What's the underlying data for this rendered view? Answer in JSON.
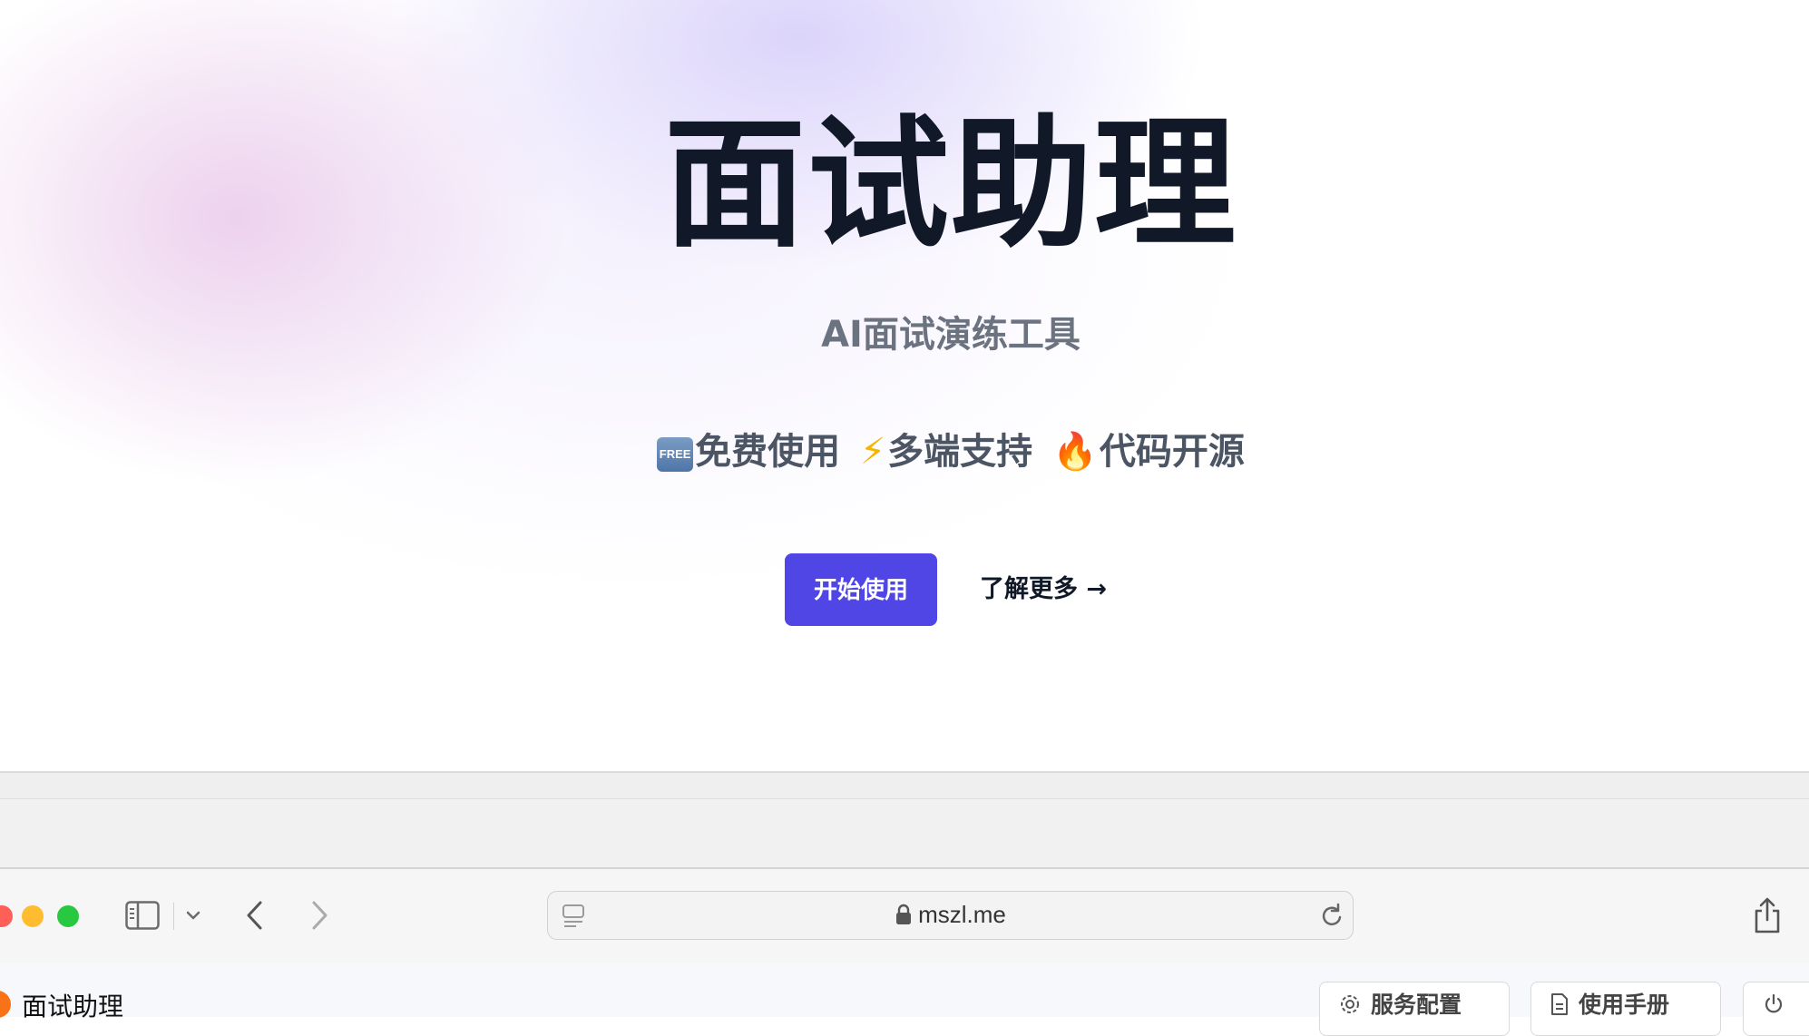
{
  "hero": {
    "title": "面试助理",
    "subtitle": "AI面试演练工具",
    "features": [
      {
        "badge": "FREE",
        "label": "免费使用"
      },
      {
        "icon": "⚡",
        "label": "多端支持"
      },
      {
        "icon": "🔥",
        "label": "代码开源"
      }
    ],
    "primary_button": "开始使用",
    "secondary_link": "了解更多 →"
  },
  "browser": {
    "url": "mszl.me"
  },
  "app": {
    "title": "面试助理",
    "buttons": {
      "service_config": "服务配置",
      "user_manual": "使用手册"
    }
  },
  "colors": {
    "accent": "#4f46e5",
    "title": "#111827",
    "subtitle": "#6b7280"
  }
}
